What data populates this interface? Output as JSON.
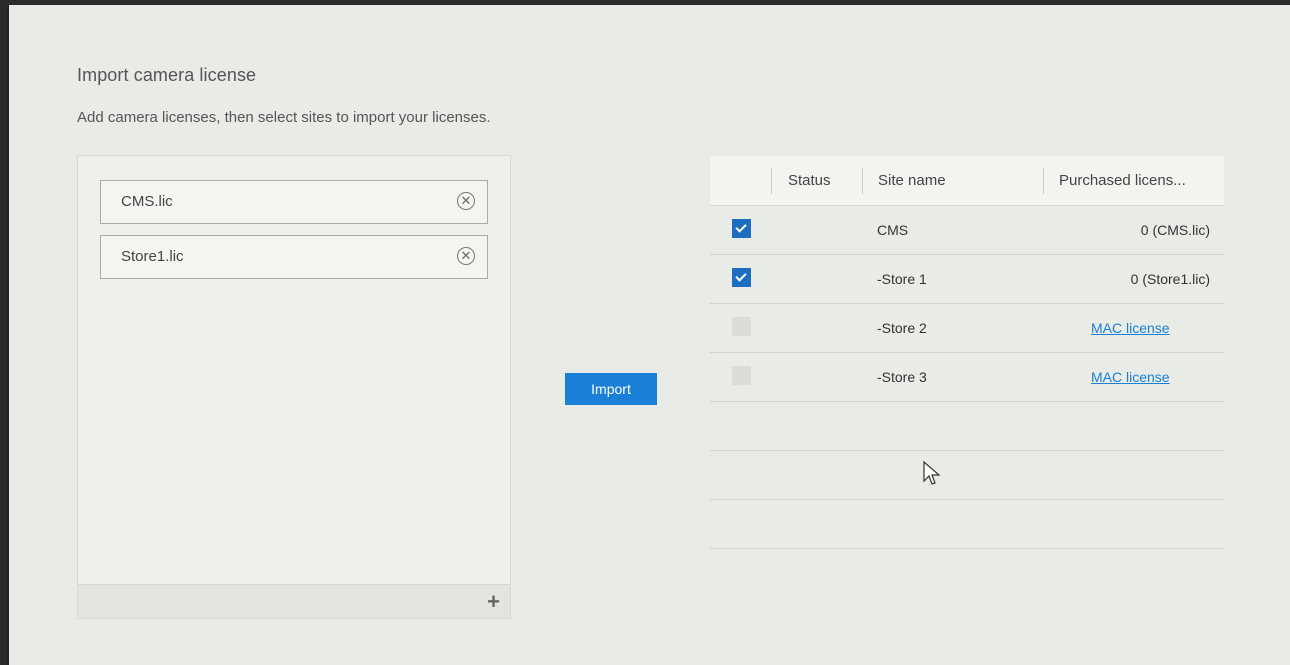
{
  "page": {
    "title": "Import camera license",
    "subtitle": "Add camera licenses, then select sites to import your licenses."
  },
  "licenses": [
    {
      "name": "CMS.lic"
    },
    {
      "name": "Store1.lic"
    }
  ],
  "import_button": "Import",
  "table": {
    "columns": [
      "Status",
      "Site name",
      "Purchased licens..."
    ],
    "rows": [
      {
        "checked": true,
        "site": "CMS",
        "purchased": "0 (CMS.lic)"
      },
      {
        "checked": true,
        "site": "-Store 1",
        "purchased": "0 (Store1.lic)"
      },
      {
        "checked": false,
        "site": "-Store 2",
        "link": "MAC license"
      },
      {
        "checked": false,
        "site": "-Store 3",
        "link": "MAC license"
      }
    ]
  },
  "icons": {
    "remove": "close-circle-icon",
    "add": "plus-icon"
  },
  "colors": {
    "accent": "#1a7fd6",
    "checkbox_checked": "#1d6ec0",
    "background": "#e9ebe6"
  }
}
